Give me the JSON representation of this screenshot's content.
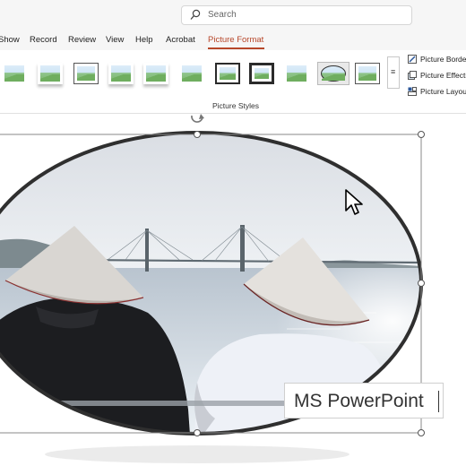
{
  "search": {
    "placeholder": "Search"
  },
  "menu": {
    "tabs": [
      {
        "label": "Show"
      },
      {
        "label": "Record"
      },
      {
        "label": "Review"
      },
      {
        "label": "View"
      },
      {
        "label": "Help"
      },
      {
        "label": "Acrobat"
      },
      {
        "label": "Picture Format",
        "active": true
      }
    ]
  },
  "ribbon": {
    "group_label": "Picture Styles",
    "commands": [
      {
        "label": "Picture Border"
      },
      {
        "label": "Picture Effects"
      },
      {
        "label": "Picture Layout"
      }
    ],
    "more_glyph": "≡"
  },
  "overlay": {
    "label": "MS PowerPoint"
  },
  "colors": {
    "accent": "#b7472a",
    "frame": "#2f2f2f"
  }
}
